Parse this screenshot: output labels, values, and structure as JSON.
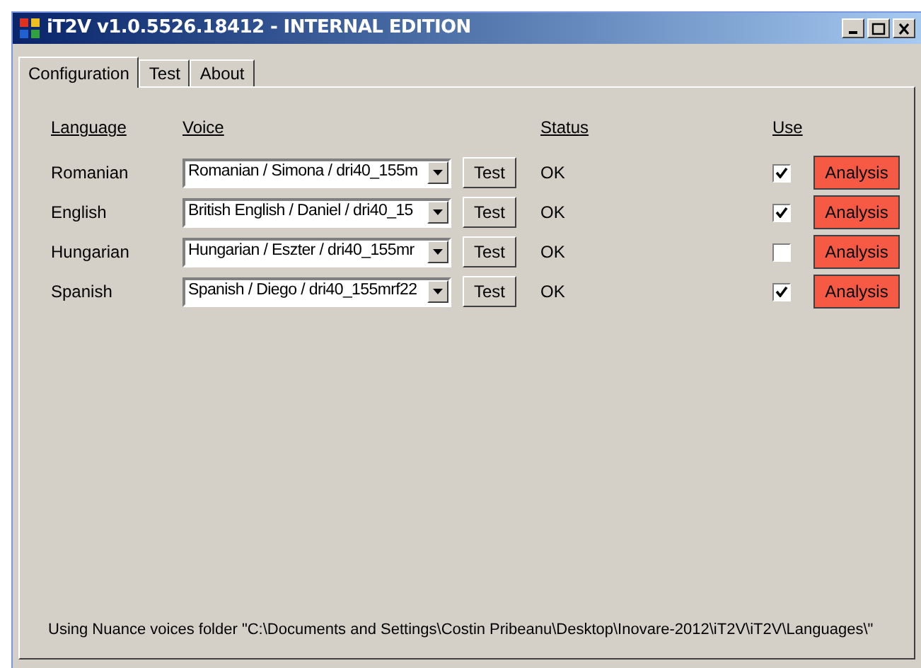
{
  "window": {
    "title": "iT2V v1.0.5526.18412 - INTERNAL EDITION"
  },
  "tabs": [
    {
      "label": "Configuration",
      "selected": true
    },
    {
      "label": "Test",
      "selected": false
    },
    {
      "label": "About",
      "selected": false
    }
  ],
  "columns": [
    "Language",
    "Voice",
    "Status",
    "Use"
  ],
  "rows": [
    {
      "language": "Romanian",
      "voice": "Romanian / Simona / dri40_155m",
      "test": "Test",
      "status": "OK",
      "use": true,
      "analysis": "Analysis"
    },
    {
      "language": "English",
      "voice": "British English / Daniel / dri40_15",
      "test": "Test",
      "status": "OK",
      "use": true,
      "analysis": "Analysis"
    },
    {
      "language": "Hungarian",
      "voice": "Hungarian / Eszter / dri40_155mr",
      "test": "Test",
      "status": "OK",
      "use": false,
      "analysis": "Analysis"
    },
    {
      "language": "Spanish",
      "voice": "Spanish / Diego / dri40_155mrf22",
      "test": "Test",
      "status": "OK",
      "use": true,
      "analysis": "Analysis"
    }
  ],
  "status_bar": "Using Nuance voices folder \"C:\\Documents and Settings\\Costin Pribeanu\\Desktop\\Inovare-2012\\iT2V\\iT2V\\Languages\\\""
}
